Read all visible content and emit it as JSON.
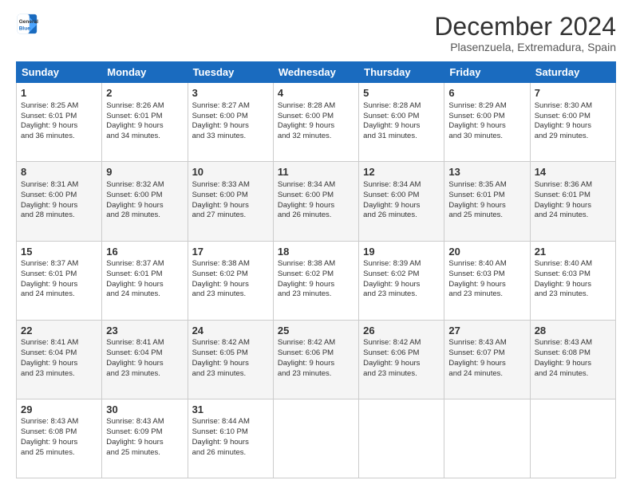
{
  "logo": {
    "line1": "General",
    "line2": "Blue"
  },
  "title": "December 2024",
  "subtitle": "Plasenzuela, Extremadura, Spain",
  "days_header": [
    "Sunday",
    "Monday",
    "Tuesday",
    "Wednesday",
    "Thursday",
    "Friday",
    "Saturday"
  ],
  "weeks": [
    [
      {
        "day": "1",
        "lines": [
          "Sunrise: 8:25 AM",
          "Sunset: 6:01 PM",
          "Daylight: 9 hours",
          "and 36 minutes."
        ]
      },
      {
        "day": "2",
        "lines": [
          "Sunrise: 8:26 AM",
          "Sunset: 6:01 PM",
          "Daylight: 9 hours",
          "and 34 minutes."
        ]
      },
      {
        "day": "3",
        "lines": [
          "Sunrise: 8:27 AM",
          "Sunset: 6:00 PM",
          "Daylight: 9 hours",
          "and 33 minutes."
        ]
      },
      {
        "day": "4",
        "lines": [
          "Sunrise: 8:28 AM",
          "Sunset: 6:00 PM",
          "Daylight: 9 hours",
          "and 32 minutes."
        ]
      },
      {
        "day": "5",
        "lines": [
          "Sunrise: 8:28 AM",
          "Sunset: 6:00 PM",
          "Daylight: 9 hours",
          "and 31 minutes."
        ]
      },
      {
        "day": "6",
        "lines": [
          "Sunrise: 8:29 AM",
          "Sunset: 6:00 PM",
          "Daylight: 9 hours",
          "and 30 minutes."
        ]
      },
      {
        "day": "7",
        "lines": [
          "Sunrise: 8:30 AM",
          "Sunset: 6:00 PM",
          "Daylight: 9 hours",
          "and 29 minutes."
        ]
      }
    ],
    [
      {
        "day": "8",
        "lines": [
          "Sunrise: 8:31 AM",
          "Sunset: 6:00 PM",
          "Daylight: 9 hours",
          "and 28 minutes."
        ]
      },
      {
        "day": "9",
        "lines": [
          "Sunrise: 8:32 AM",
          "Sunset: 6:00 PM",
          "Daylight: 9 hours",
          "and 28 minutes."
        ]
      },
      {
        "day": "10",
        "lines": [
          "Sunrise: 8:33 AM",
          "Sunset: 6:00 PM",
          "Daylight: 9 hours",
          "and 27 minutes."
        ]
      },
      {
        "day": "11",
        "lines": [
          "Sunrise: 8:34 AM",
          "Sunset: 6:00 PM",
          "Daylight: 9 hours",
          "and 26 minutes."
        ]
      },
      {
        "day": "12",
        "lines": [
          "Sunrise: 8:34 AM",
          "Sunset: 6:00 PM",
          "Daylight: 9 hours",
          "and 26 minutes."
        ]
      },
      {
        "day": "13",
        "lines": [
          "Sunrise: 8:35 AM",
          "Sunset: 6:01 PM",
          "Daylight: 9 hours",
          "and 25 minutes."
        ]
      },
      {
        "day": "14",
        "lines": [
          "Sunrise: 8:36 AM",
          "Sunset: 6:01 PM",
          "Daylight: 9 hours",
          "and 24 minutes."
        ]
      }
    ],
    [
      {
        "day": "15",
        "lines": [
          "Sunrise: 8:37 AM",
          "Sunset: 6:01 PM",
          "Daylight: 9 hours",
          "and 24 minutes."
        ]
      },
      {
        "day": "16",
        "lines": [
          "Sunrise: 8:37 AM",
          "Sunset: 6:01 PM",
          "Daylight: 9 hours",
          "and 24 minutes."
        ]
      },
      {
        "day": "17",
        "lines": [
          "Sunrise: 8:38 AM",
          "Sunset: 6:02 PM",
          "Daylight: 9 hours",
          "and 23 minutes."
        ]
      },
      {
        "day": "18",
        "lines": [
          "Sunrise: 8:38 AM",
          "Sunset: 6:02 PM",
          "Daylight: 9 hours",
          "and 23 minutes."
        ]
      },
      {
        "day": "19",
        "lines": [
          "Sunrise: 8:39 AM",
          "Sunset: 6:02 PM",
          "Daylight: 9 hours",
          "and 23 minutes."
        ]
      },
      {
        "day": "20",
        "lines": [
          "Sunrise: 8:40 AM",
          "Sunset: 6:03 PM",
          "Daylight: 9 hours",
          "and 23 minutes."
        ]
      },
      {
        "day": "21",
        "lines": [
          "Sunrise: 8:40 AM",
          "Sunset: 6:03 PM",
          "Daylight: 9 hours",
          "and 23 minutes."
        ]
      }
    ],
    [
      {
        "day": "22",
        "lines": [
          "Sunrise: 8:41 AM",
          "Sunset: 6:04 PM",
          "Daylight: 9 hours",
          "and 23 minutes."
        ]
      },
      {
        "day": "23",
        "lines": [
          "Sunrise: 8:41 AM",
          "Sunset: 6:04 PM",
          "Daylight: 9 hours",
          "and 23 minutes."
        ]
      },
      {
        "day": "24",
        "lines": [
          "Sunrise: 8:42 AM",
          "Sunset: 6:05 PM",
          "Daylight: 9 hours",
          "and 23 minutes."
        ]
      },
      {
        "day": "25",
        "lines": [
          "Sunrise: 8:42 AM",
          "Sunset: 6:06 PM",
          "Daylight: 9 hours",
          "and 23 minutes."
        ]
      },
      {
        "day": "26",
        "lines": [
          "Sunrise: 8:42 AM",
          "Sunset: 6:06 PM",
          "Daylight: 9 hours",
          "and 23 minutes."
        ]
      },
      {
        "day": "27",
        "lines": [
          "Sunrise: 8:43 AM",
          "Sunset: 6:07 PM",
          "Daylight: 9 hours",
          "and 24 minutes."
        ]
      },
      {
        "day": "28",
        "lines": [
          "Sunrise: 8:43 AM",
          "Sunset: 6:08 PM",
          "Daylight: 9 hours",
          "and 24 minutes."
        ]
      }
    ],
    [
      {
        "day": "29",
        "lines": [
          "Sunrise: 8:43 AM",
          "Sunset: 6:08 PM",
          "Daylight: 9 hours",
          "and 25 minutes."
        ]
      },
      {
        "day": "30",
        "lines": [
          "Sunrise: 8:43 AM",
          "Sunset: 6:09 PM",
          "Daylight: 9 hours",
          "and 25 minutes."
        ]
      },
      {
        "day": "31",
        "lines": [
          "Sunrise: 8:44 AM",
          "Sunset: 6:10 PM",
          "Daylight: 9 hours",
          "and 26 minutes."
        ]
      },
      null,
      null,
      null,
      null
    ]
  ]
}
